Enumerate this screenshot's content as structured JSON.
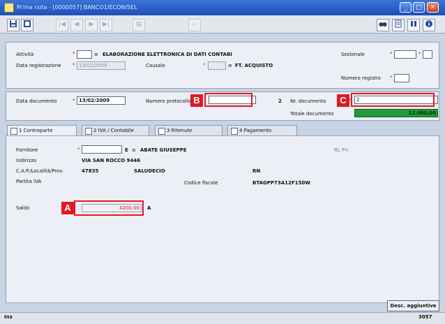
{
  "window": {
    "title": "Prima nota - [0000057] BANCO1/ECON/SEL",
    "minimize": "_",
    "maximize": "□",
    "close": "✕"
  },
  "toolbar": {
    "save_icon": "save-icon",
    "grid_icon": "grid-icon",
    "first": "|◀",
    "prev": "◀",
    "next": "▶",
    "last": "▶|",
    "print": "▤",
    "search": "⌕"
  },
  "header": {
    "attivita_label": "Attività",
    "attivita_desc": "ELABORAZIONE ELETTRONICA DI DATI CONTABI",
    "data_registrazione_label": "Data registrazione",
    "data_registrazione_value": "13/02/2009",
    "causale_label": "Causale",
    "causale_desc": "FT. ACQUISTO",
    "sezionale_label": "Sezionale",
    "numero_registro_label": "Numero registro"
  },
  "document": {
    "data_documento_label": "Data documento",
    "data_documento_value": "13/02/2009",
    "numero_protocollo_label": "Numero protocollo",
    "numero_protocollo_value": "",
    "protocollo_suffix": "2",
    "nr_documento_label": "Nr. documento",
    "nr_documento_value": "2",
    "totale_documento_label": "Totale documento",
    "totale_documento_value": "12.000,00"
  },
  "tabs": [
    {
      "label": "1 Controparte"
    },
    {
      "label": "2 IVA / Contabile"
    },
    {
      "label": "3 Ritenute"
    },
    {
      "label": "4 Pagamento"
    }
  ],
  "controparte": {
    "fornitore_label": "Fornitore",
    "fornitore_suffix": "E",
    "fornitore_name": "ABATE GIUSEPPE",
    "indirizzo_label": "Indirizzo",
    "indirizzo_value": "VIA SAN ROCCO 9446",
    "cap_label": "C.A.P./Località/Prov.",
    "cap_value": "47835",
    "localita_value": "SALUDECIO",
    "provincia_value": "RN",
    "piva_label": "Partita IVA",
    "codice_fiscale_label": "Codice fiscale",
    "codice_fiscale_value": "BTAGPP73A12F150W",
    "saldo_label": "Saldo",
    "saldo_value": "4200,00",
    "saldo_suffix": "A",
    "extra_label": "RL P+"
  },
  "callouts": {
    "a": "A",
    "b": "B",
    "c": "C"
  },
  "footer": {
    "desc_button": "Desc. aggiuntive",
    "mode": "Ins",
    "code": "3057"
  },
  "colors": {
    "callout": "#e11921",
    "total_bg": "#1f9b3b",
    "title_bar": "#2457c5"
  }
}
